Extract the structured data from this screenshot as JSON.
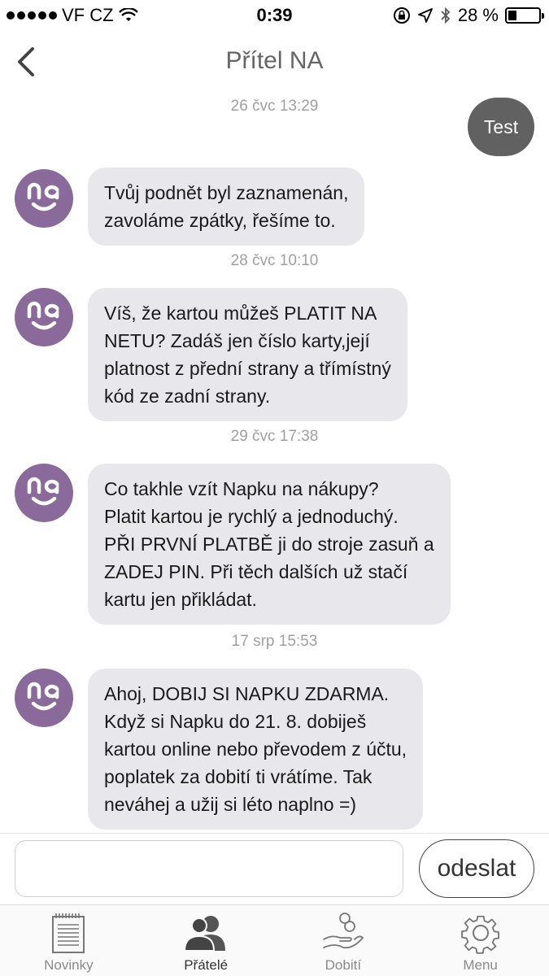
{
  "status_bar": {
    "carrier": "VF CZ",
    "time": "0:39",
    "battery_text": "28 %",
    "battery_level": 0.28
  },
  "header": {
    "title": "Přítel NA"
  },
  "messages": [
    {
      "type": "timestamp",
      "text": "26 čvc 13:29"
    },
    {
      "type": "outgoing",
      "text": "Test"
    },
    {
      "type": "incoming",
      "text": "Tvůj podnět byl zaznamenán,\nzavoláme zpátky, řešíme to."
    },
    {
      "type": "timestamp",
      "text": "28 čvc 10:10"
    },
    {
      "type": "incoming",
      "text": "Víš, že kartou můžeš PLATIT NA\nNETU? Zadáš jen číslo karty,její\nplatnost z přední strany a třímístný\nkód ze zadní strany."
    },
    {
      "type": "timestamp",
      "text": "29 čvc 17:38"
    },
    {
      "type": "incoming",
      "text": "Co takhle vzít Napku na nákupy?\nPlatit kartou je rychlý a jednoduchý.\nPŘI PRVNÍ PLATBĚ ji do stroje zasuň a\nZADEJ PIN. Při těch dalších už stačí\nkartu jen přikládat."
    },
    {
      "type": "timestamp",
      "text": "17 srp 15:53"
    },
    {
      "type": "incoming",
      "text": "Ahoj, DOBIJ SI NAPKU ZDARMA.\nKdyž si Napku do 21. 8. dobiješ\nkartou online nebo převodem z účtu,\npoplatek za dobití ti vrátíme. Tak\nneváhej a užij si léto naplno =)"
    }
  ],
  "avatar": {
    "label": "na",
    "color": "#8a6a9a"
  },
  "compose": {
    "input_value": "",
    "send_label": "odeslat"
  },
  "tabs": [
    {
      "label": "Novinky",
      "icon": "newspaper-icon",
      "active": false
    },
    {
      "label": "Přátelé",
      "icon": "friends-icon",
      "active": true
    },
    {
      "label": "Dobití",
      "icon": "top-up-icon",
      "active": false
    },
    {
      "label": "Menu",
      "icon": "gear-icon",
      "active": false
    }
  ]
}
